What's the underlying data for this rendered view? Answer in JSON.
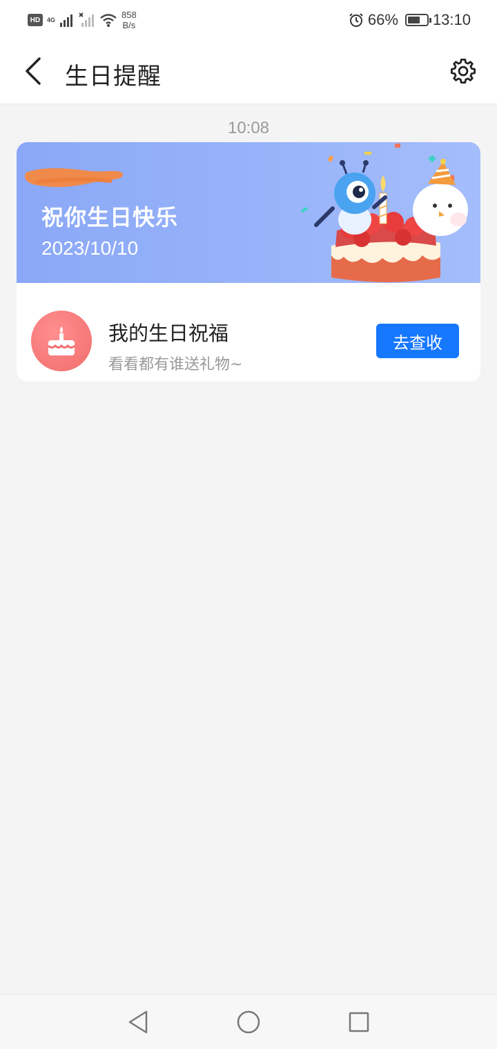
{
  "status_bar": {
    "hd_label": "HD",
    "network_type": "4G",
    "speed_value": "858",
    "speed_unit": "B/s",
    "battery": "66%",
    "battery_level": 0.66,
    "time": "13:10",
    "icons": [
      "hd-icon",
      "signal-icon",
      "signal-off-icon",
      "wifi-icon",
      "alarm-icon",
      "battery-icon"
    ]
  },
  "header": {
    "title": "生日提醒",
    "back_icon": "back-icon",
    "settings_icon": "gear-icon"
  },
  "message": {
    "timestamp": "10:08",
    "banner": {
      "title": "祝你生日快乐",
      "date": "2023/10/10",
      "colors": {
        "start": "#8aa8f7",
        "end": "#a4bdfb"
      }
    },
    "gift": {
      "title": "我的生日祝福",
      "subtitle": "看看都有谁送礼物~",
      "button": "去查收",
      "icon": "cake-icon",
      "button_color": "#1677ff"
    }
  },
  "nav_bar": {
    "icons": [
      "nav-back-icon",
      "nav-home-icon",
      "nav-recents-icon"
    ]
  }
}
